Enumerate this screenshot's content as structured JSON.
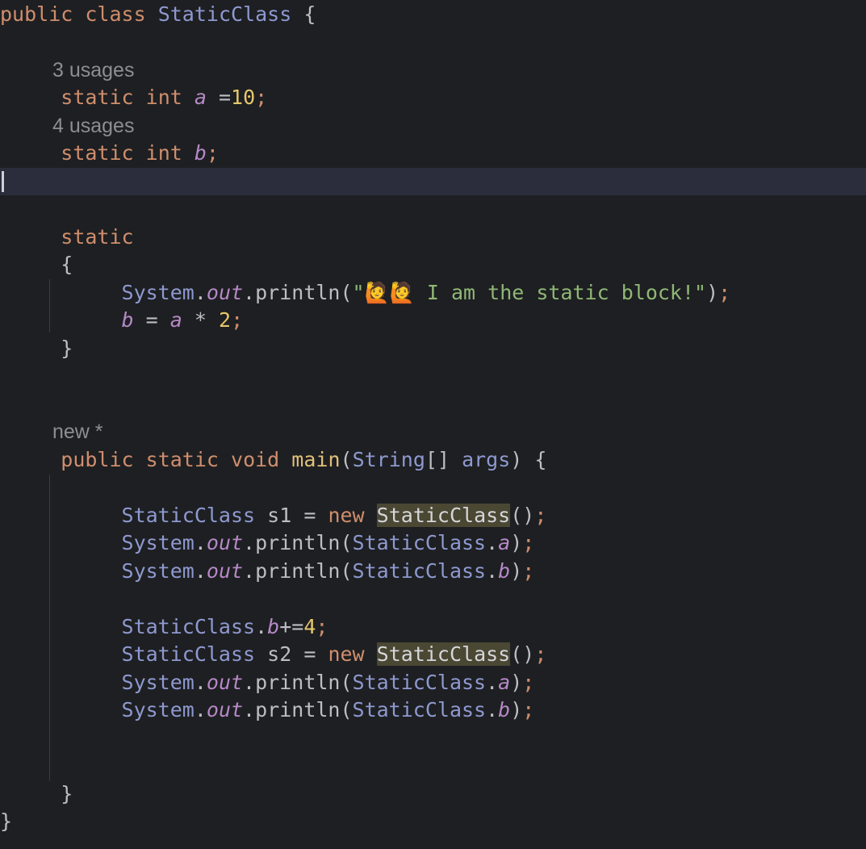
{
  "editor": {
    "hints": {
      "a_usages": "3 usages",
      "b_usages": "4 usages",
      "main_author": "new *"
    },
    "code": {
      "kw_public": "public",
      "kw_class": "class",
      "kw_static": "static",
      "kw_int": "int",
      "kw_void": "void",
      "kw_new": "new",
      "class_name": "StaticClass",
      "type_system": "System",
      "type_string": "String",
      "field_out": "out",
      "method_println": "println",
      "method_main": "main",
      "param_args": "args",
      "var_a": "a",
      "var_b": "b",
      "var_s1": "s1",
      "var_s2": "s2",
      "num_10": "10",
      "num_2": "2",
      "num_4": "4",
      "string_literal": "\"🙋🙋 I am the static block!\""
    },
    "colors": {
      "background": "#1e1f22",
      "current_line": "#2b2d3c",
      "keyword": "#cf8e6d",
      "class": "#8e99d0",
      "field": "#b589c6",
      "number": "#e6c76b",
      "string": "#8fb876"
    }
  }
}
